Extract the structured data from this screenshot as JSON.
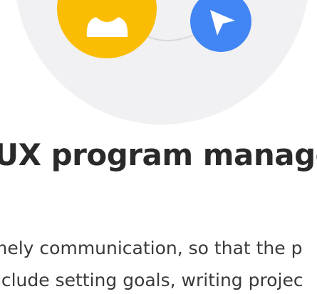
{
  "article": {
    "title": "UX program manage",
    "body_lines": [
      "mely communication, so that the p",
      "nclude setting goals, writing projec"
    ]
  },
  "illustration": {
    "background_color": "#f1f1f3",
    "left_icon": "person-badge-icon",
    "left_icon_color": "#fbbc04",
    "right_icon": "cursor-icon",
    "right_icon_color": "#4285f4"
  }
}
